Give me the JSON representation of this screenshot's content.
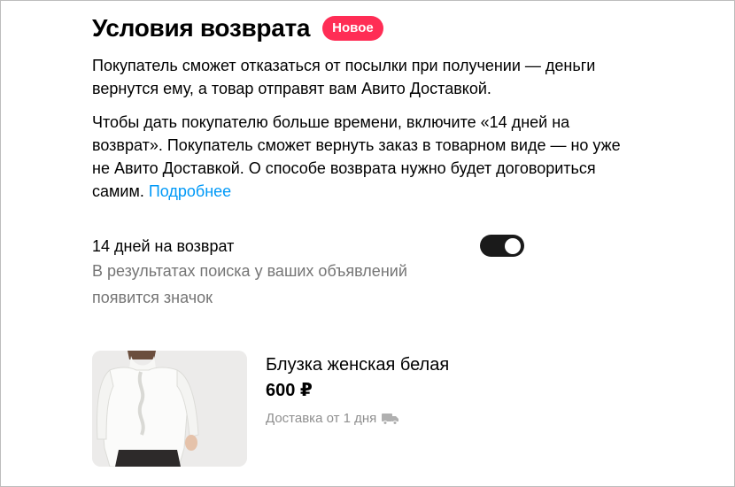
{
  "header": {
    "title": "Условия возврата",
    "badge": "Новое"
  },
  "description": {
    "paragraph1": "Покупатель сможет отказаться от посылки при получении — деньги вернутся ему, а товар отправят вам Авито Доставкой.",
    "paragraph2": "Чтобы дать покупателю больше времени, включите «14 дней на возврат». Покупатель сможет вернуть заказ в товарном виде — но уже не Авито Доставкой. О способе возврата нужно будет договориться самим.",
    "link": "Подробнее"
  },
  "option": {
    "title": "14 дней на возврат",
    "description": "В результатах поиска у ваших объявлений появится значок",
    "enabled": true
  },
  "product": {
    "name": "Блузка женская белая",
    "price": "600 ₽",
    "delivery": "Доставка от 1 дня",
    "delivery_icon": "truck-icon",
    "image": "white-blouse-photo"
  },
  "colors": {
    "badge": "#ff2d55",
    "link": "#0099f7",
    "toggle_on": "#1a1a1a",
    "muted_text": "#757575"
  }
}
